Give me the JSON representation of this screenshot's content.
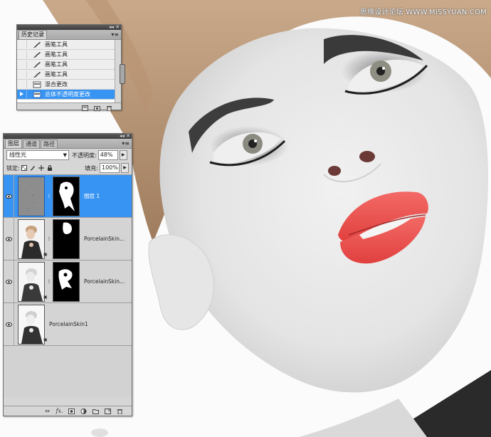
{
  "watermark": "思缘设计论坛 WWW.MISSYUAN.COM",
  "history_panel": {
    "tab": "历史记录",
    "items": [
      {
        "label": "画笔工具",
        "icon": "brush-icon"
      },
      {
        "label": "画笔工具",
        "icon": "brush-icon"
      },
      {
        "label": "画笔工具",
        "icon": "brush-icon"
      },
      {
        "label": "画笔工具",
        "icon": "brush-icon"
      },
      {
        "label": "混合更改",
        "icon": "blend-change-icon"
      },
      {
        "label": "总体不透明度更改",
        "icon": "opacity-change-icon",
        "selected": true
      }
    ]
  },
  "layers_panel": {
    "tabs": [
      "图层",
      "通道",
      "路径"
    ],
    "active_tab": "图层",
    "blend_mode": "线性光",
    "opacity_label": "不透明度:",
    "opacity_value": "48%",
    "lock_label": "锁定:",
    "fill_label": "填充:",
    "fill_value": "100%",
    "layers": [
      {
        "name": "图层 1",
        "selected": true
      },
      {
        "name": "PorcelainSkin..."
      },
      {
        "name": "PorcelainSkin..."
      },
      {
        "name": "PorcelainSkin1"
      }
    ],
    "footer_fx": "fx."
  },
  "colors": {
    "selection": "#3894f2",
    "panel_bg": "#d6d6d6",
    "lip_red": "#ef5352"
  }
}
